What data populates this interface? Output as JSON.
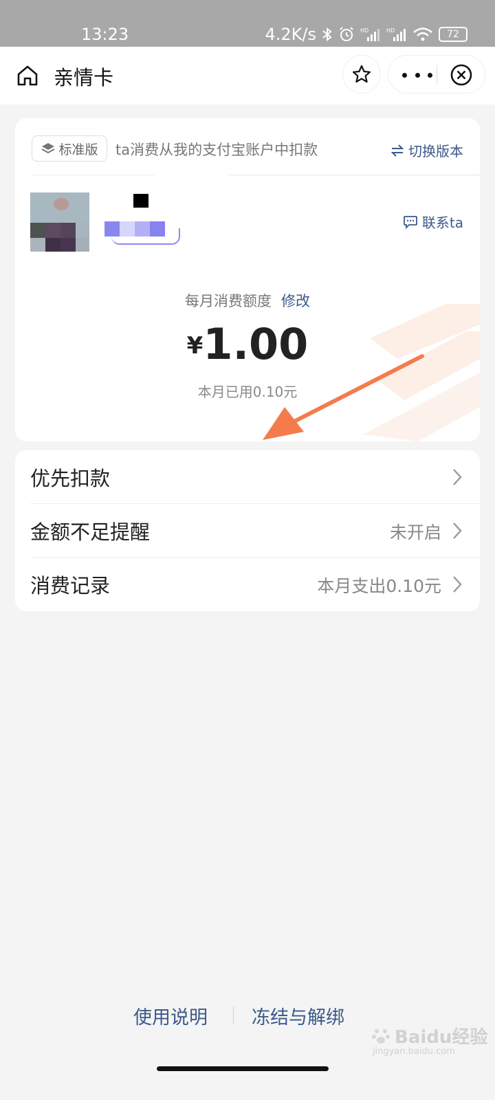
{
  "status_bar": {
    "time": "13:23",
    "network_speed": "4.2K/s",
    "battery": "72",
    "icons": [
      "bluetooth-icon",
      "alarm-icon",
      "signal-hd-icon",
      "signal-hd-icon",
      "wifi-icon",
      "battery-icon"
    ]
  },
  "header": {
    "title": "亲情卡",
    "icons": [
      "home-icon",
      "star-icon",
      "more-icon",
      "close-icon"
    ]
  },
  "card": {
    "version_tag": "标准版",
    "description": "ta消费从我的支付宝账户中扣款",
    "switch_label": "切换版本",
    "contact_label": "联系ta",
    "limit_label": "每月消费额度",
    "edit_label": "修改",
    "currency": "¥",
    "amount": "1.00",
    "used_text": "本月已用0.10元"
  },
  "list": [
    {
      "label": "优先扣款",
      "value": ""
    },
    {
      "label": "金额不足提醒",
      "value": "未开启"
    },
    {
      "label": "消费记录",
      "value": "本月支出0.10元"
    }
  ],
  "footer": {
    "link1": "使用说明",
    "link2": "冻结与解绑"
  },
  "watermark": {
    "brand": "Baidu经验",
    "url": "jingyan.baidu.com"
  },
  "colors": {
    "link_blue": "#3b5a8a",
    "annotation_arrow": "#f47c4c",
    "status_bar_bg": "#a8a8a8",
    "page_bg": "#f4f4f4"
  }
}
